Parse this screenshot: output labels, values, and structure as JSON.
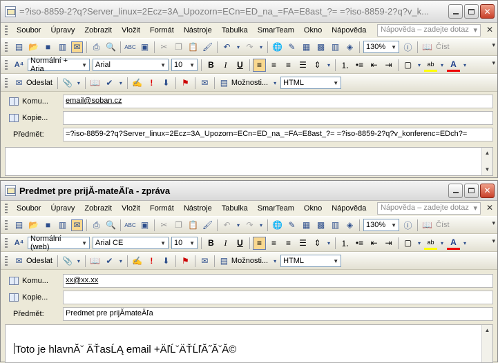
{
  "window1": {
    "title": "=?iso-8859-2?q?Server_linux=2Ecz=3A_Upozorn=ECn=ED_na_=FA=E8ast_?= =?iso-8859-2?q?v_k...",
    "to": "email@soban.cz",
    "cc": "",
    "subject": "=?iso-8859-2?q?Server_linux=2Ecz=3A_Upozorn=ECn=ED_na_=FA=E8ast_?= =?iso-8859-2?q?v_konferenc=EDch?=",
    "style": "Normální + Aria",
    "font": "Arial",
    "size": "10"
  },
  "window2": {
    "title": "Predmet pre prijĂ-mateÄľa - zpráva",
    "to": "xx@xx.xx",
    "cc": "",
    "subject": "Predmet pre prijĂmateÄľa",
    "style": "Normální (web)",
    "font": "Arial CE",
    "size": "10",
    "body": "Toto je hlavnĂˇ ÄŤasĹĄ email +ÄľĹˇÄŤĹľĂ˝Ăˇ­Ă©"
  },
  "menu": [
    "Soubor",
    "Úpravy",
    "Zobrazit",
    "Vložit",
    "Formát",
    "Nástroje",
    "Tabulka",
    "SmarTeam",
    "Okno",
    "Nápověda"
  ],
  "help_placeholder": "Nápověda – zadejte dotaz",
  "zoom": "130%",
  "read_label": "Číst",
  "send_label": "Odeslat",
  "options_label": "Možnosti...",
  "format_label": "HTML",
  "labels": {
    "to": "Komu...",
    "cc": "Kopie...",
    "subject": "Předmět:"
  }
}
